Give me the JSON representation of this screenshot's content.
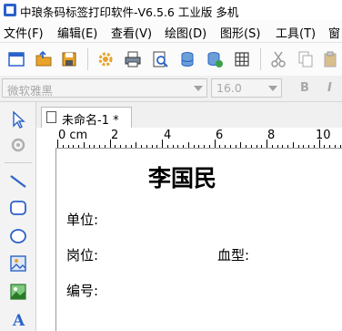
{
  "window": {
    "title": "中琅条码标签打印软件-V6.5.6 工业版 多机"
  },
  "menu": [
    "文件(F)",
    "编辑(E)",
    "查看(V)",
    "绘图(D)",
    "图形(S)",
    "工具(T)",
    "窗"
  ],
  "toolbar": {
    "icons": [
      "new-document-icon",
      "open-folder-icon",
      "save-icon",
      "settings-gear-icon",
      "print-icon",
      "print-preview-icon",
      "database-icon",
      "database-settings-icon",
      "grid-icon",
      "cut-icon",
      "copy-icon",
      "paste-icon"
    ]
  },
  "fontbar": {
    "font_name": "微软雅黑",
    "font_size": "16.0",
    "bold": "B",
    "italic": "I"
  },
  "left_tools": {
    "icons": [
      "select-pointer-icon",
      "rotate-icon",
      "line-icon",
      "rounded-rect-icon",
      "ellipse-icon",
      "image-icon",
      "picture-icon",
      "text-icon"
    ]
  },
  "document": {
    "tab_title": "未命名-1 *"
  },
  "ruler": {
    "unit": "0 cm",
    "labels": [
      "2",
      "4",
      "6",
      "8",
      "10"
    ]
  },
  "label": {
    "name": "李国民",
    "unit": "单位:",
    "position": "岗位:",
    "blood_type": "血型:",
    "number": "编号:"
  },
  "colors": {
    "accent_blue": "#2b62c9",
    "toolbar_orange": "#e8a42a"
  }
}
